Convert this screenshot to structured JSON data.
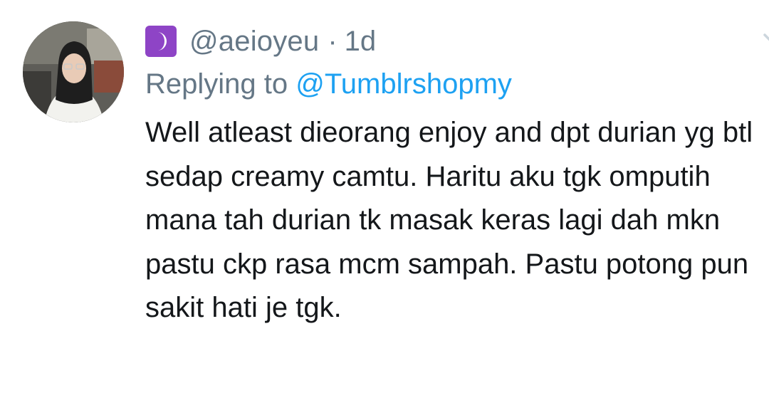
{
  "tweet": {
    "author_handle": "@aeioyeu",
    "separator": "·",
    "timestamp": "1d",
    "reply_prefix": "Replying to",
    "reply_to": "@Tumblrshopmy",
    "body": "Well atleast dieorang enjoy and dpt durian yg btl sedap creamy camtu. Haritu aku tgk omputih mana tah durian tk masak keras lagi dah mkn pastu ckp rasa mcm sampah. Pastu potong pun sakit hati je tgk."
  },
  "icons": {
    "avatar": "avatar",
    "name_badge": "crescent-moon-emoji-icon",
    "menu": "chevron-down-icon"
  },
  "colors": {
    "secondary_text": "#657786",
    "link": "#1da1f2",
    "primary_text": "#14171a",
    "badge_bg": "#8e44c6"
  }
}
